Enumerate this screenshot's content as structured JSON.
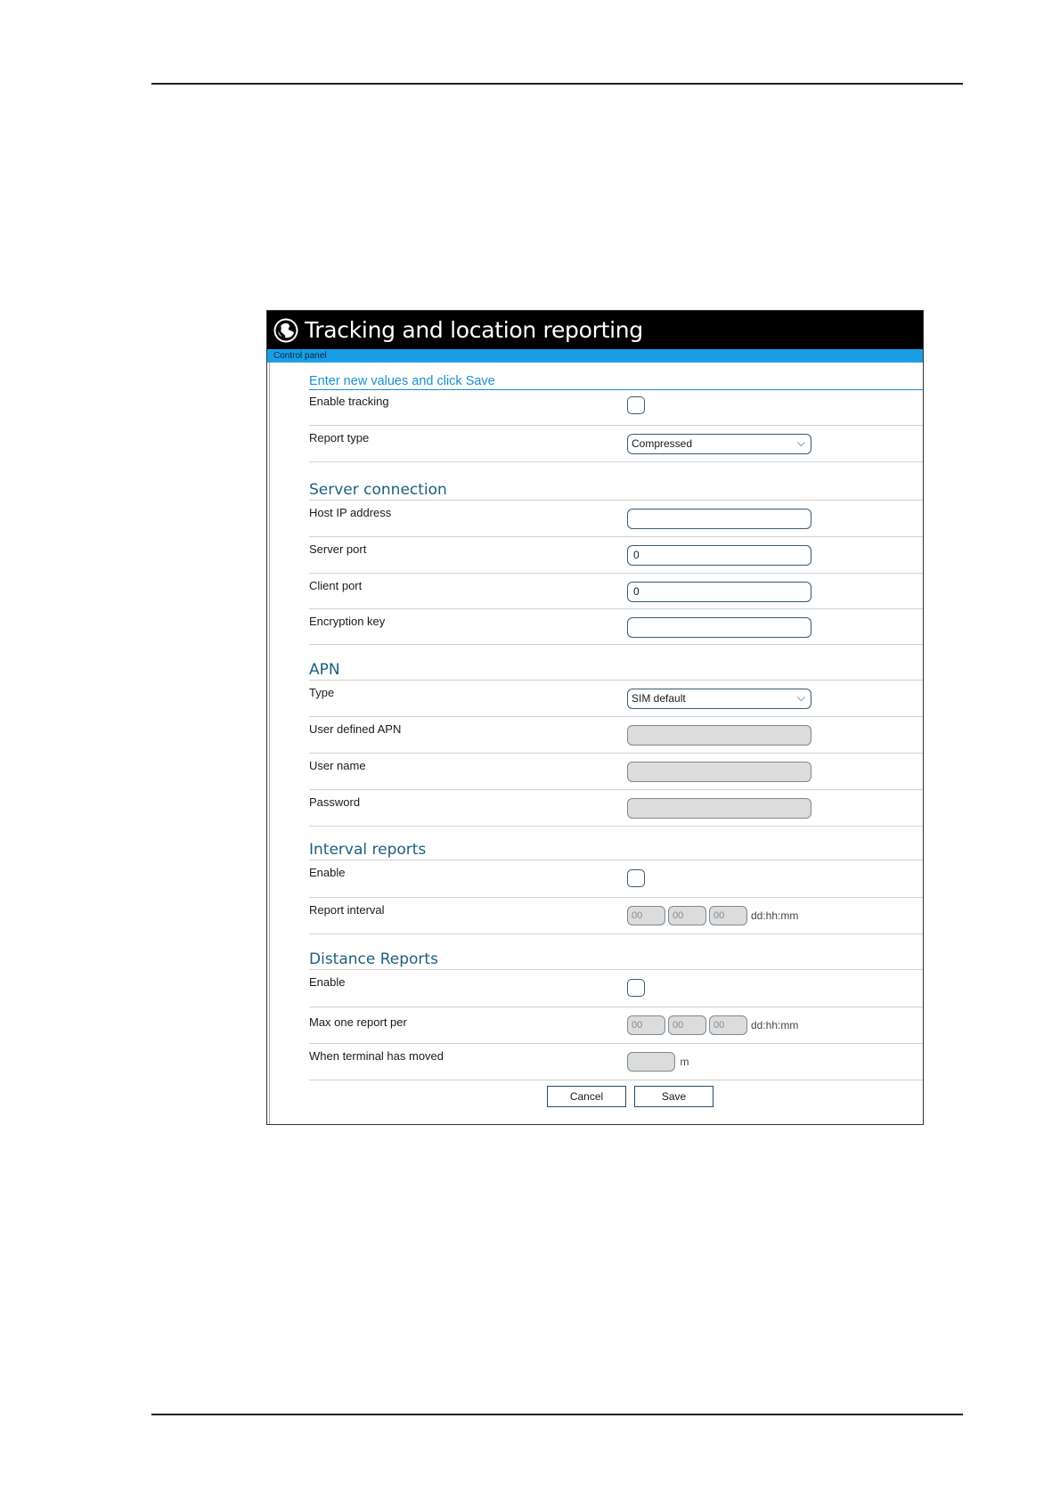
{
  "window": {
    "title": "Tracking and location reporting",
    "breadcrumb": "Control panel"
  },
  "form": {
    "intro": "Enter new values and click Save",
    "general": {
      "enable_tracking_label": "Enable tracking",
      "report_type_label": "Report type",
      "report_type_value": "Compressed"
    },
    "server": {
      "heading": "Server connection",
      "host_label": "Host IP address",
      "host_value": "",
      "server_port_label": "Server port",
      "server_port_value": "0",
      "client_port_label": "Client port",
      "client_port_value": "0",
      "encryption_label": "Encryption key",
      "encryption_value": ""
    },
    "apn": {
      "heading": "APN",
      "type_label": "Type",
      "type_value": "SIM default",
      "user_apn_label": "User defined APN",
      "username_label": "User name",
      "password_label": "Password"
    },
    "interval": {
      "heading": "Interval reports",
      "enable_label": "Enable",
      "report_interval_label": "Report interval",
      "dd": "00",
      "hh": "00",
      "mm": "00",
      "unit": "dd:hh:mm"
    },
    "distance": {
      "heading": "Distance Reports",
      "enable_label": "Enable",
      "max_label": "Max one report per",
      "dd": "00",
      "hh": "00",
      "mm": "00",
      "unit": "dd:hh:mm",
      "moved_label": "When terminal has moved",
      "moved_unit": "m"
    }
  },
  "buttons": {
    "cancel": "Cancel",
    "save": "Save"
  }
}
